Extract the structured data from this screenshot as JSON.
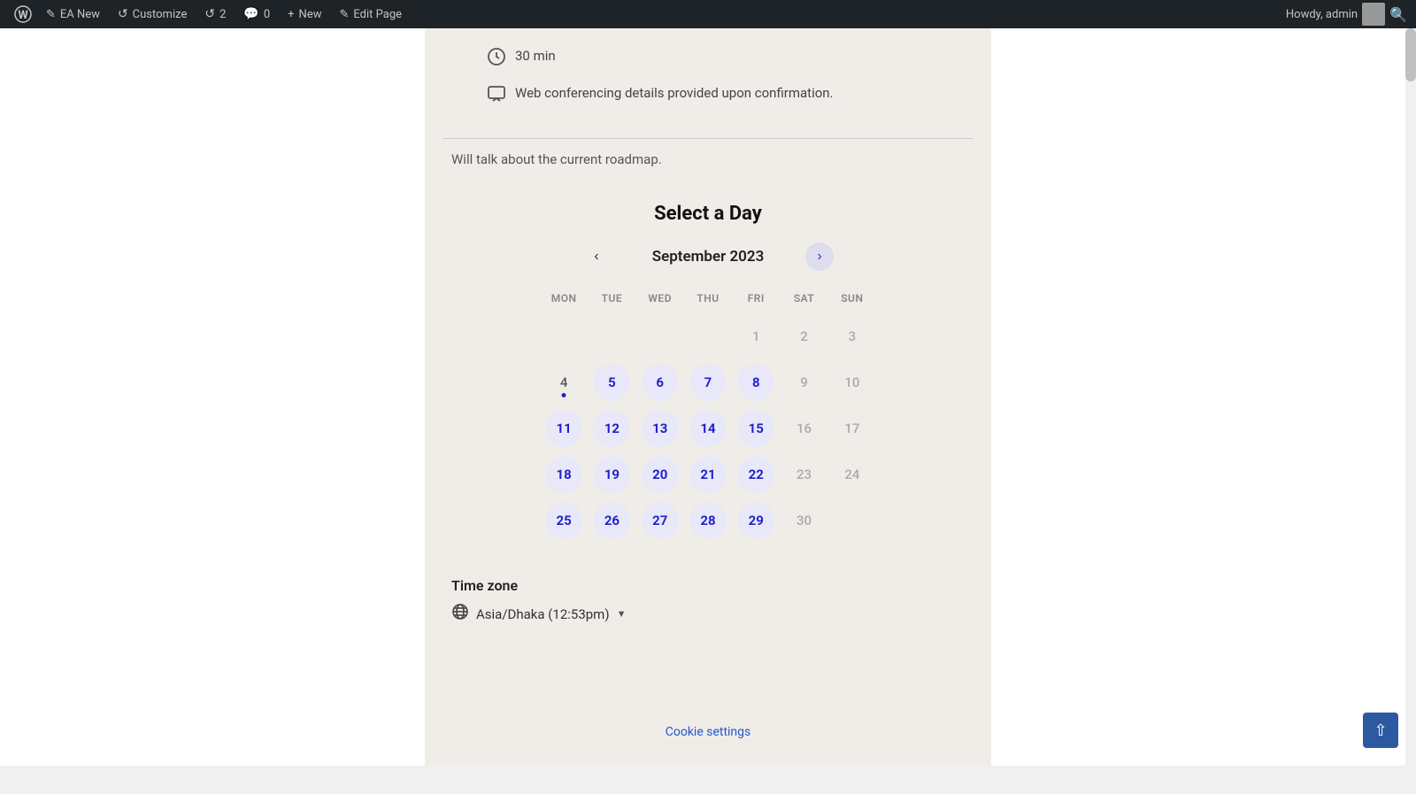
{
  "adminbar": {
    "wp_logo": "⊕",
    "items": [
      {
        "id": "wp-logo",
        "label": "",
        "icon": "wordpress"
      },
      {
        "id": "ea-new",
        "label": "EA New",
        "icon": "✎"
      },
      {
        "id": "customize",
        "label": "Customize",
        "icon": "↺"
      },
      {
        "id": "revisions",
        "label": "2",
        "icon": "↺"
      },
      {
        "id": "comments",
        "label": "0",
        "icon": "💬"
      },
      {
        "id": "new",
        "label": "New",
        "icon": "+"
      },
      {
        "id": "edit-page",
        "label": "Edit Page",
        "icon": "✎"
      }
    ],
    "howdy": "Howdy, admin",
    "search_icon": "🔍"
  },
  "page": {
    "duration": "30 min",
    "conferencing_text": "Web conferencing details provided upon confirmation.",
    "roadmap_text": "Will talk about the current roadmap.",
    "calendar_title": "Select a Day",
    "month": "September 2023",
    "day_headers": [
      "MON",
      "TUE",
      "WED",
      "THU",
      "FRI",
      "SAT",
      "SUN"
    ],
    "calendar": {
      "weeks": [
        [
          {
            "day": "",
            "type": "empty"
          },
          {
            "day": "",
            "type": "empty"
          },
          {
            "day": "",
            "type": "empty"
          },
          {
            "day": "",
            "type": "empty"
          },
          {
            "day": "1",
            "type": "unavailable"
          },
          {
            "day": "2",
            "type": "unavailable"
          },
          {
            "day": "3",
            "type": "unavailable"
          }
        ],
        [
          {
            "day": "4",
            "type": "today"
          },
          {
            "day": "5",
            "type": "available"
          },
          {
            "day": "6",
            "type": "available"
          },
          {
            "day": "7",
            "type": "available"
          },
          {
            "day": "8",
            "type": "available"
          },
          {
            "day": "9",
            "type": "unavailable"
          },
          {
            "day": "10",
            "type": "unavailable"
          }
        ],
        [
          {
            "day": "11",
            "type": "available"
          },
          {
            "day": "12",
            "type": "available"
          },
          {
            "day": "13",
            "type": "available"
          },
          {
            "day": "14",
            "type": "available"
          },
          {
            "day": "15",
            "type": "available"
          },
          {
            "day": "16",
            "type": "unavailable"
          },
          {
            "day": "17",
            "type": "unavailable"
          }
        ],
        [
          {
            "day": "18",
            "type": "available"
          },
          {
            "day": "19",
            "type": "available"
          },
          {
            "day": "20",
            "type": "available"
          },
          {
            "day": "21",
            "type": "available"
          },
          {
            "day": "22",
            "type": "available"
          },
          {
            "day": "23",
            "type": "unavailable"
          },
          {
            "day": "24",
            "type": "unavailable"
          }
        ],
        [
          {
            "day": "25",
            "type": "available"
          },
          {
            "day": "26",
            "type": "available"
          },
          {
            "day": "27",
            "type": "available"
          },
          {
            "day": "28",
            "type": "available"
          },
          {
            "day": "29",
            "type": "available"
          },
          {
            "day": "30",
            "type": "unavailable"
          },
          {
            "day": "",
            "type": "empty"
          }
        ]
      ]
    },
    "timezone_label": "Time zone",
    "timezone_value": "Asia/Dhaka (12:53pm)",
    "cookie_settings": "Cookie settings"
  }
}
